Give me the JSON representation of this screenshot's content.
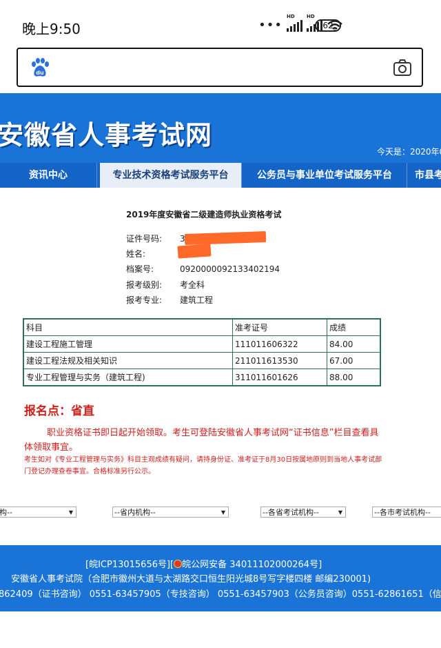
{
  "status_bar": {
    "time": "晚上9:50",
    "dots": "•••",
    "signal1_label": "HD",
    "signal2_label": "HD",
    "battery": "62"
  },
  "search": {
    "left_icon": "baidu-paw-icon",
    "right_icon": "camera-icon"
  },
  "banner": {
    "title": "安徽省人事考试网",
    "date_text": "今天是：2020年0"
  },
  "nav": {
    "items": [
      {
        "label": "资讯中心"
      },
      {
        "label": "专业技术资格考试服务平台"
      },
      {
        "label": "公务员与事业单位考试服务平台"
      },
      {
        "label": "市县考"
      }
    ]
  },
  "result": {
    "exam_title": "2019年度安徽省二级建造师执业资格考试",
    "fields": [
      {
        "label": "证件号码:",
        "value": "34"
      },
      {
        "label": "姓名:",
        "value": ""
      },
      {
        "label": "档案号:",
        "value": "0920000092133402194"
      },
      {
        "label": "报考级别:",
        "value": "考全科"
      },
      {
        "label": "报考专业:",
        "value": "建筑工程"
      }
    ],
    "table": {
      "headers": [
        "科目",
        "准考证号",
        "成绩"
      ],
      "rows": [
        [
          "建设工程施工管理",
          "111011606322",
          "84.00"
        ],
        [
          "建设工程法规及相关知识",
          "211011613530",
          "67.00"
        ],
        [
          "专业工程管理与实务（建筑工程)",
          "311011601626",
          "88.00"
        ]
      ]
    },
    "reg_point": "报名点：省直",
    "notice_main": "职业资格证书即日起开始领取。考生可登陆安徽省人事考试网“证书信息”栏目查看具体领取事宜。",
    "notice_small": "考生如对《专业工程管理与实务》科目主观成绩有疑问，请持身份证、准考证于8月30日按属地原则到当地人事考试部门登记办理查卷事宜。合格标准另行公示。"
  },
  "links": {
    "selects": [
      {
        "value": "构--"
      },
      {
        "value": "--省内机构--"
      },
      {
        "value": "--各省考试机构--"
      },
      {
        "value": "--各市考试机构--"
      }
    ]
  },
  "footer": {
    "line1_a": "[皖ICP13015656号][",
    "line1_b": "皖公网安备 34011102000264号]",
    "line2": "安徽省人事考试院（合肥市徽州大道与太湖路交口恒生阳光城8号写字楼四楼 邮编230001)",
    "line3": "862409（证书咨询） 0551-63457905（专技咨询） 0551-63457903（公务员咨询）0551-62861651（信息"
  },
  "colors": {
    "banner_blue": "#1a73d6",
    "nav_blue": "#1464c8",
    "notice_red": "#d0201c",
    "table_border": "#2f6f58",
    "redaction_orange": "#ff6a2a"
  }
}
